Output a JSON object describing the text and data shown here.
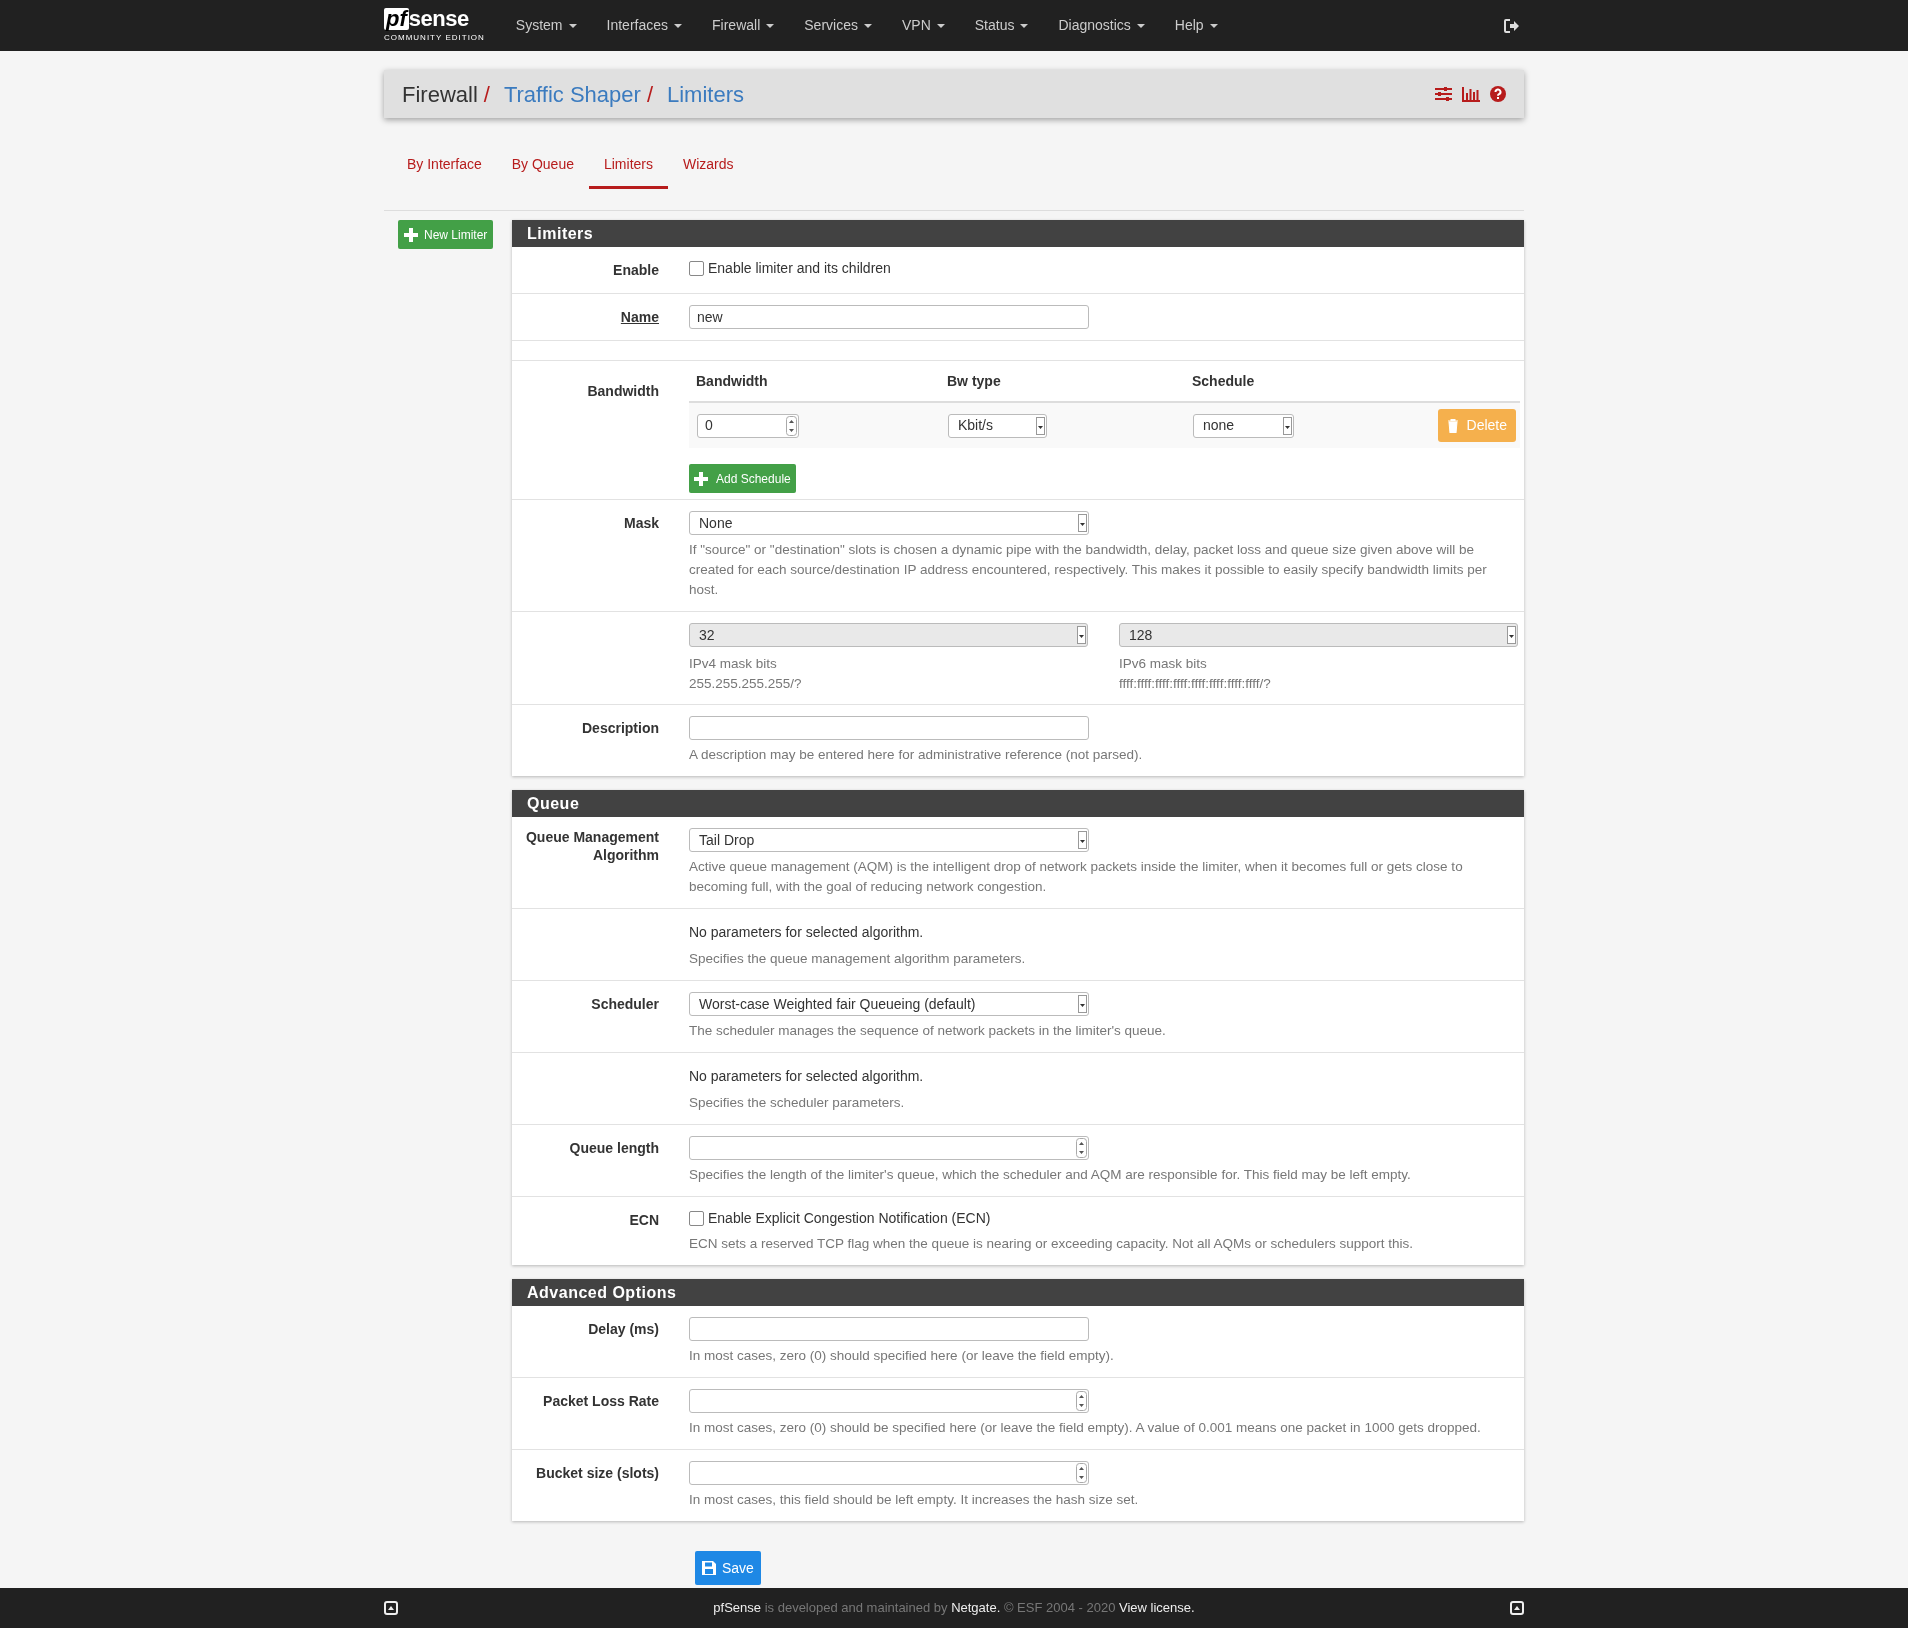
{
  "navbar": {
    "logo": {
      "mark": "pf",
      "word": "sense",
      "edition": "COMMUNITY EDITION"
    },
    "menus": [
      {
        "label": "System"
      },
      {
        "label": "Interfaces"
      },
      {
        "label": "Firewall"
      },
      {
        "label": "Services"
      },
      {
        "label": "VPN"
      },
      {
        "label": "Status"
      },
      {
        "label": "Diagnostics"
      },
      {
        "label": "Help"
      }
    ]
  },
  "breadcrumb": {
    "separator": "/",
    "items": [
      {
        "text": "Firewall",
        "link": false
      },
      {
        "text": "Traffic Shaper",
        "link": true
      },
      {
        "text": "Limiters",
        "link": true
      }
    ]
  },
  "tabs": [
    {
      "label": "By Interface",
      "selected": false
    },
    {
      "label": "By Queue",
      "selected": false
    },
    {
      "label": "Limiters",
      "selected": true
    },
    {
      "label": "Wizards",
      "selected": false
    }
  ],
  "new_limiter_button": "New Limiter",
  "sections": [
    {
      "title": "Limiters",
      "rows": [
        {
          "kind": "checkbox",
          "label": "Enable",
          "checked": false,
          "text": "Enable limiter and its children"
        },
        {
          "kind": "input",
          "label": "Name",
          "label_underlined": true,
          "value": "new",
          "spinner": false
        },
        {
          "kind": "bandwidth",
          "label": "Bandwidth",
          "columns": [
            "Bandwidth",
            "Bw type",
            "Schedule"
          ],
          "bandwidth": "0",
          "bw_type": "Kbit/s",
          "schedule": "none",
          "delete_button": "Delete",
          "add_button": "Add Schedule"
        },
        {
          "kind": "select",
          "label": "Mask",
          "value": "None",
          "help": "If \"source\" or \"destination\" slots is chosen a dynamic pipe with the bandwidth, delay, packet loss and queue size given above will be created for each source/destination IP address encountered, respectively. This makes it possible to easily specify bandwidth limits per host."
        },
        {
          "kind": "maskbits",
          "fields": [
            {
              "value": "32",
              "disabled": true,
              "caption": "IPv4 mask bits",
              "subcaption": "255.255.255.255/?"
            },
            {
              "value": "128",
              "disabled": true,
              "caption": "IPv6 mask bits",
              "subcaption": "ffff:ffff:ffff:ffff:ffff:ffff:ffff:ffff/?"
            }
          ]
        },
        {
          "kind": "input",
          "label": "Description",
          "label_underlined": false,
          "spinner": false,
          "help": "A description may be entered here for administrative reference (not parsed)."
        }
      ]
    },
    {
      "title": "Queue",
      "rows": [
        {
          "kind": "select",
          "label": "Queue Management Algorithm",
          "value": "Tail Drop",
          "help": "Active queue management (AQM) is the intelligent drop of network packets inside the limiter, when it becomes full or gets close to becoming full, with the goal of reducing network congestion."
        },
        {
          "kind": "info",
          "text": "No parameters for selected algorithm.",
          "help": "Specifies the queue management algorithm parameters."
        },
        {
          "kind": "select",
          "label": "Scheduler",
          "value": "Worst-case Weighted fair Queueing (default)",
          "help": "The scheduler manages the sequence of network packets in the limiter's queue."
        },
        {
          "kind": "info",
          "text": "No parameters for selected algorithm.",
          "help": "Specifies the scheduler parameters."
        },
        {
          "kind": "input",
          "label": "Queue length",
          "label_underlined": false,
          "spinner": true,
          "help": "Specifies the length of the limiter's queue, which the scheduler and AQM are responsible for. This field may be left empty."
        },
        {
          "kind": "checkbox",
          "label": "ECN",
          "checked": false,
          "text": "Enable Explicit Congestion Notification (ECN)",
          "help": "ECN sets a reserved TCP flag when the queue is nearing or exceeding capacity. Not all AQMs or schedulers support this."
        }
      ]
    },
    {
      "title": "Advanced Options",
      "rows": [
        {
          "kind": "input",
          "label": "Delay (ms)",
          "label_underlined": false,
          "spinner": false,
          "help": "In most cases, zero (0) should specified here (or leave the field empty)."
        },
        {
          "kind": "input",
          "label": "Packet Loss Rate",
          "label_underlined": false,
          "spinner": true,
          "help": "In most cases, zero (0) should be specified here (or leave the field empty). A value of 0.001 means one packet in 1000 gets dropped."
        },
        {
          "kind": "input",
          "label": "Bucket size (slots)",
          "label_underlined": false,
          "spinner": true,
          "help": "In most cases, this field should be left empty. It increases the hash size set."
        }
      ]
    }
  ],
  "save_button": "Save",
  "footer": [
    {
      "text": "pfSense",
      "link": true
    },
    {
      "text": " is developed and maintained by ",
      "link": false
    },
    {
      "text": "Netgate.",
      "link": true
    },
    {
      "text": " © ESF 2004 - 2020 ",
      "link": false
    },
    {
      "text": "View license.",
      "link": true
    }
  ]
}
